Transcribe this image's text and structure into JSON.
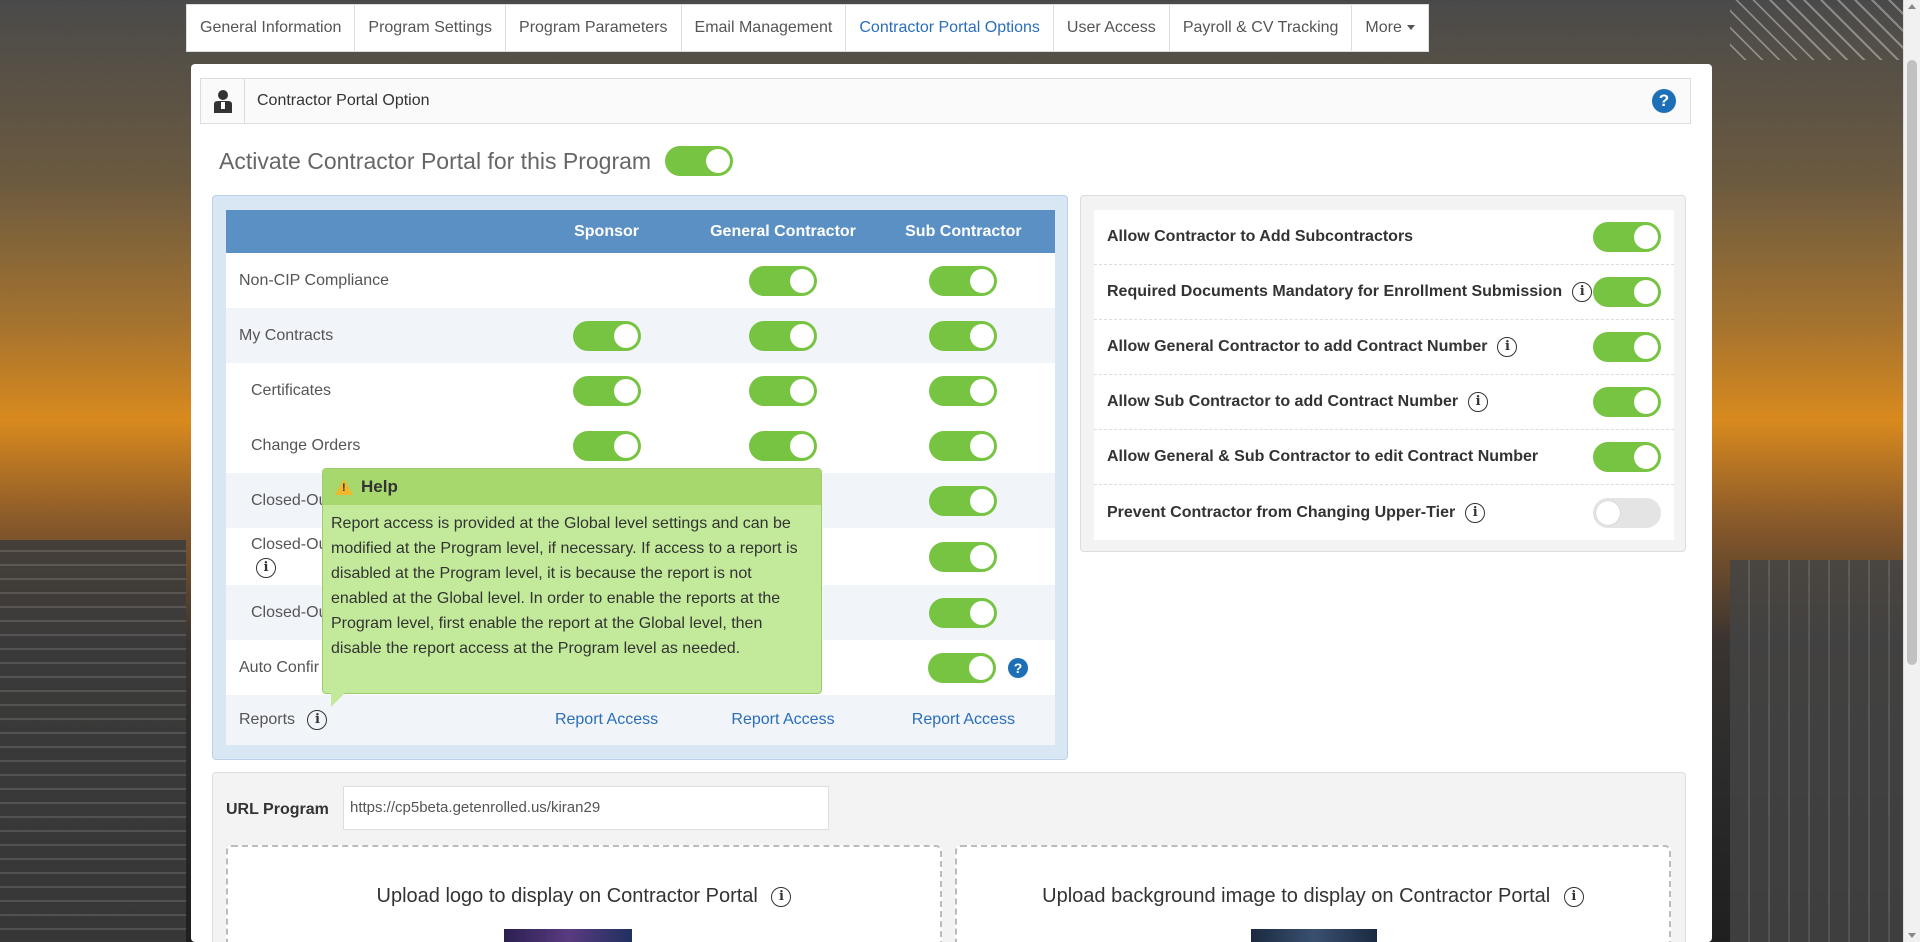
{
  "tabs": [
    {
      "label": "General Information",
      "active": false
    },
    {
      "label": "Program Settings",
      "active": false
    },
    {
      "label": "Program Parameters",
      "active": false
    },
    {
      "label": "Email Management",
      "active": false
    },
    {
      "label": "Contractor Portal Options",
      "active": true
    },
    {
      "label": "User Access",
      "active": false
    },
    {
      "label": "Payroll & CV Tracking",
      "active": false
    },
    {
      "label": "More",
      "active": false
    }
  ],
  "panel": {
    "title": "Contractor Portal Option",
    "help_icon": "question-circle-icon"
  },
  "activate": {
    "label": "Activate Contractor Portal for this Program",
    "enabled": true
  },
  "access_table": {
    "headers": {
      "blank": "",
      "sponsor": "Sponsor",
      "general_contractor": "General Contractor",
      "sub_contractor": "Sub Contractor"
    },
    "rows": [
      {
        "label": "Non-CIP Compliance",
        "sponsor": null,
        "gc": true,
        "sub": true
      },
      {
        "label": "My Contracts",
        "sponsor": true,
        "gc": true,
        "sub": true
      },
      {
        "label": "Certificates",
        "sponsor": true,
        "gc": true,
        "sub": true
      },
      {
        "label": "Change Orders",
        "sponsor": true,
        "gc": true,
        "sub": true
      },
      {
        "label": "Closed-Ou",
        "sponsor": null,
        "gc": null,
        "sub": true
      },
      {
        "label": "Closed-Ou",
        "sponsor": null,
        "gc": null,
        "sub": true
      },
      {
        "label": "Closed-Ou",
        "sponsor": null,
        "gc": null,
        "sub": true
      },
      {
        "label": "Auto Confir",
        "sponsor": null,
        "gc": null,
        "sub": true
      }
    ],
    "reports": {
      "label": "Reports",
      "sponsor_link": "Report Access",
      "gc_link": "Report Access",
      "sub_link": "Report Access"
    }
  },
  "options": [
    {
      "label": "Allow Contractor to Add Subcontractors",
      "info": false,
      "enabled": true
    },
    {
      "label": "Required Documents Mandatory for Enrollment Submission",
      "info": true,
      "enabled": true
    },
    {
      "label": "Allow General Contractor to add Contract Number",
      "info": true,
      "enabled": true
    },
    {
      "label": "Allow Sub Contractor to add Contract Number",
      "info": true,
      "enabled": true
    },
    {
      "label": "Allow General & Sub Contractor to edit Contract Number",
      "info": false,
      "enabled": true
    },
    {
      "label": "Prevent Contractor from Changing Upper-Tier",
      "info": true,
      "enabled": false
    }
  ],
  "url": {
    "label": "URL Program",
    "value": "https://cp5beta.getenrolled.us/kiran29"
  },
  "uploads": {
    "logo_title": "Upload logo to display on Contractor Portal",
    "background_title": "Upload background image to display on Contractor Portal"
  },
  "tooltip": {
    "title": "Help",
    "body": "Report access is provided at the Global level settings and can be modified at the Program level, if necessary. If access to a report is disabled at the Program level, it is because the report is not enabled at the Global level. In order to enable the reports at the Program level, first enable the report at the Global level, then disable the report access at the Program level as needed."
  },
  "colors": {
    "accent": "#2a6ebb",
    "toggle_on": "#76c442",
    "table_header": "#5b90c4",
    "tooltip_bg": "#c2ea9a"
  }
}
